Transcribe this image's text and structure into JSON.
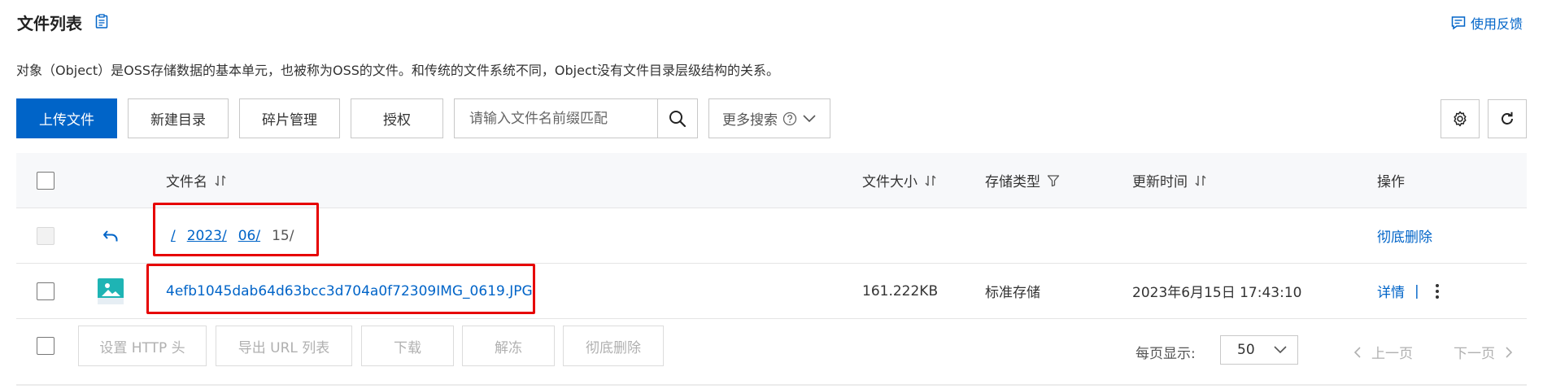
{
  "header": {
    "title": "文件列表",
    "feedback_label": "使用反馈",
    "description": "对象（Object）是OSS存储数据的基本单元，也被称为OSS的文件。和传统的文件系统不同，Object没有文件目录层级结构的关系。"
  },
  "toolbar": {
    "upload_label": "上传文件",
    "new_dir_label": "新建目录",
    "fragments_label": "碎片管理",
    "authorize_label": "授权",
    "search_placeholder": "请输入文件名前缀匹配",
    "more_search_label": "更多搜索",
    "icons": [
      "gear-icon",
      "refresh-icon",
      "search-icon",
      "help-circle-icon",
      "chevron-down-icon"
    ]
  },
  "table": {
    "columns": {
      "name": "文件名",
      "size": "文件大小",
      "storage": "存储类型",
      "updated": "更新时间",
      "actions": "操作"
    },
    "breadcrumb": {
      "root": "/",
      "seg1": "2023/",
      "seg2": "06/",
      "current": "15/",
      "delete_label": "彻底删除"
    },
    "rows": [
      {
        "name": "4efb1045dab64d63bcc3d704a0f72309IMG_0619.JPG",
        "size": "161.222KB",
        "storage": "标准存储",
        "updated": "2023年6月15日 17:43:10",
        "detail_label": "详情",
        "separator": "|"
      }
    ]
  },
  "footer": {
    "set_http_header": "设置 HTTP 头",
    "export_url_list": "导出 URL 列表",
    "download": "下载",
    "unfreeze": "解冻",
    "delete": "彻底删除",
    "per_page_label": "每页显示:",
    "per_page_value": "50",
    "prev": "上一页",
    "next": "下一页"
  },
  "colors": {
    "primary": "#0064c8",
    "highlight": "#e60000",
    "header_bg": "#f7f8fa"
  }
}
